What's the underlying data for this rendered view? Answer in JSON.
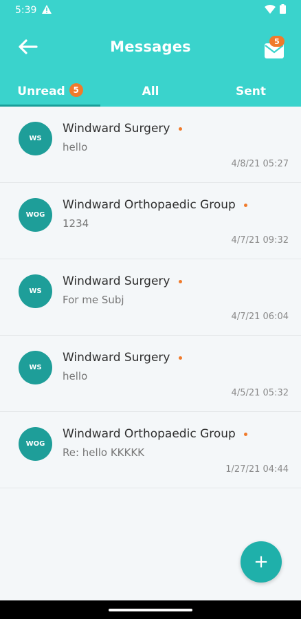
{
  "status_bar": {
    "time": "5:39",
    "warning_icon": "warning-triangle-icon",
    "wifi_icon": "wifi-icon",
    "battery_icon": "battery-icon"
  },
  "header": {
    "title": "Messages",
    "back_icon": "arrow-left-icon",
    "mail_icon": "envelope-icon",
    "mail_badge": "5"
  },
  "tabs": [
    {
      "label": "Unread",
      "badge": "5",
      "active": true
    },
    {
      "label": "All"
    },
    {
      "label": "Sent"
    }
  ],
  "messages": [
    {
      "initials": "WS",
      "sender": "Windward Surgery",
      "preview": "hello",
      "date": "4/8/21 05:27"
    },
    {
      "initials": "WOG",
      "sender": "Windward Orthopaedic Group",
      "preview": "1234",
      "date": "4/7/21 09:32"
    },
    {
      "initials": "WS",
      "sender": "Windward Surgery",
      "preview": "For me Subj",
      "date": "4/7/21 06:04"
    },
    {
      "initials": "WS",
      "sender": "Windward Surgery",
      "preview": "hello",
      "date": "4/5/21 05:32"
    },
    {
      "initials": "WOG",
      "sender": "Windward Orthopaedic Group",
      "preview": "Re: hello KKKKK",
      "date": "1/27/21 04:44"
    }
  ],
  "fab": {
    "label": "+"
  },
  "colors": {
    "primary": "#3ad3cc",
    "accent": "#f07a2b",
    "avatar": "#1e9e99"
  }
}
